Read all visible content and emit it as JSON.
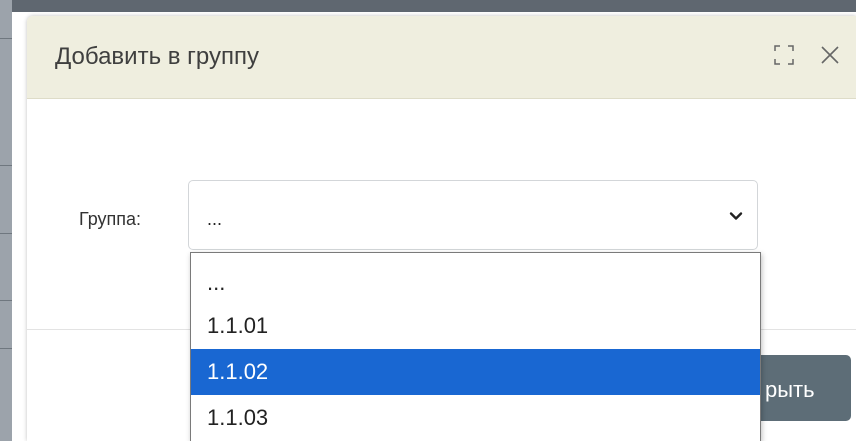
{
  "dialog": {
    "title": "Добавить в группу",
    "maximize_icon": "maximize-icon",
    "close_icon": "close-icon"
  },
  "form": {
    "group_label": "Группа:",
    "group_select": {
      "value": "...",
      "options": [
        "...",
        "1.1.01",
        "1.1.02",
        "1.1.03"
      ],
      "highlighted": "1.1.02"
    }
  },
  "footer": {
    "close_button_label_visible": "рыть"
  },
  "colors": {
    "header_bg": "#efeedf",
    "selected_option_bg": "#1967d2",
    "close_button_bg": "#5d6d77"
  }
}
